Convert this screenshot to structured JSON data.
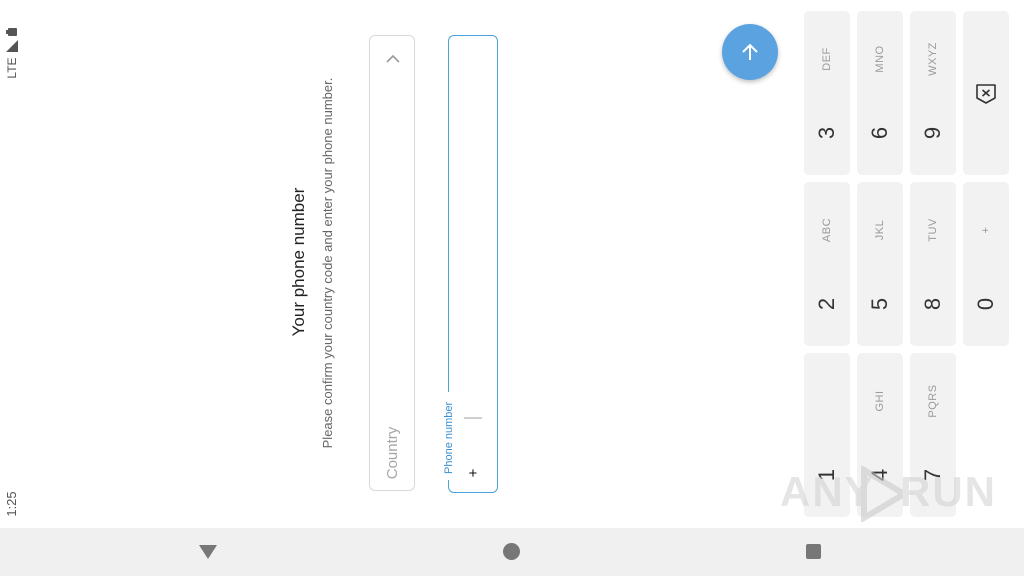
{
  "status_bar": {
    "time": "1:25",
    "network": "LTE",
    "signal_icon": "signal-icon",
    "battery_icon": "battery-icon"
  },
  "header": {
    "title": "Your phone number",
    "subtitle": "Please confirm your country code and enter your phone number."
  },
  "form": {
    "country_placeholder": "Country",
    "phone_label": "Phone number",
    "phone_prefix": "+",
    "phone_value": ""
  },
  "fab": {
    "icon": "arrow-up-icon",
    "color": "#5aa3e0"
  },
  "keypad": {
    "keys": [
      {
        "digit": "1",
        "letters": ""
      },
      {
        "digit": "2",
        "letters": "ABC"
      },
      {
        "digit": "3",
        "letters": "DEF"
      },
      {
        "digit": "4",
        "letters": "GHI"
      },
      {
        "digit": "5",
        "letters": "JKL"
      },
      {
        "digit": "6",
        "letters": "MNO"
      },
      {
        "digit": "7",
        "letters": "PQRS"
      },
      {
        "digit": "8",
        "letters": "TUV"
      },
      {
        "digit": "9",
        "letters": "WXYZ"
      },
      {
        "digit": "0",
        "letters": "+"
      }
    ],
    "backspace_icon": "backspace-icon"
  },
  "nav": {
    "back_icon": "back-triangle-icon",
    "home_icon": "home-circle-icon",
    "recent_icon": "recent-square-icon"
  },
  "watermark": {
    "text_left": "ANY",
    "text_right": "RUN"
  }
}
